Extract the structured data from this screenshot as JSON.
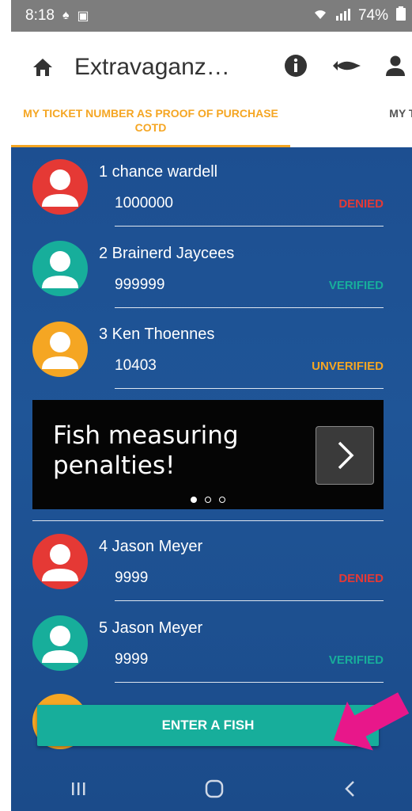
{
  "status_bar": {
    "time": "8:18",
    "battery": "74%"
  },
  "app_bar": {
    "title": "Extravaganza..."
  },
  "tabs": [
    {
      "label": "MY TICKET NUMBER AS  PROOF OF PURCHASE COTD"
    },
    {
      "label": "MY TICKET N P"
    }
  ],
  "entries": [
    {
      "name": "1 chance wardell",
      "number": "1000000",
      "status": "DENIED",
      "avatar_color": "#e53935",
      "status_color": "#e53935"
    },
    {
      "name": "2 Brainerd Jaycees",
      "number": "999999",
      "status": "VERIFIED",
      "avatar_color": "#17ae9b",
      "status_color": "#17ae9b"
    },
    {
      "name": "3 Ken Thoennes",
      "number": "10403",
      "status": "UNVERIFIED",
      "avatar_color": "#f5a623",
      "status_color": "#f5a623"
    },
    {
      "name": "4 Jason Meyer",
      "number": "9999",
      "status": "DENIED",
      "avatar_color": "#e53935",
      "status_color": "#e53935"
    },
    {
      "name": "5 Jason Meyer",
      "number": "9999",
      "status": "VERIFIED",
      "avatar_color": "#17ae9b",
      "status_color": "#17ae9b"
    }
  ],
  "banner": {
    "text": "Fish measuring penalties!",
    "active_dot": 0
  },
  "primary_action": {
    "label": "ENTER A FISH",
    "color": "#17ae9b"
  },
  "colors": {
    "accent": "#f5a623",
    "background": "#1e4f8f",
    "arrow": "#e8178a"
  },
  "icons": [
    "home-icon",
    "info-icon",
    "fish-icon",
    "person-icon",
    "chevron-right-icon",
    "back-icon",
    "recents-icon",
    "home-nav-icon"
  ]
}
